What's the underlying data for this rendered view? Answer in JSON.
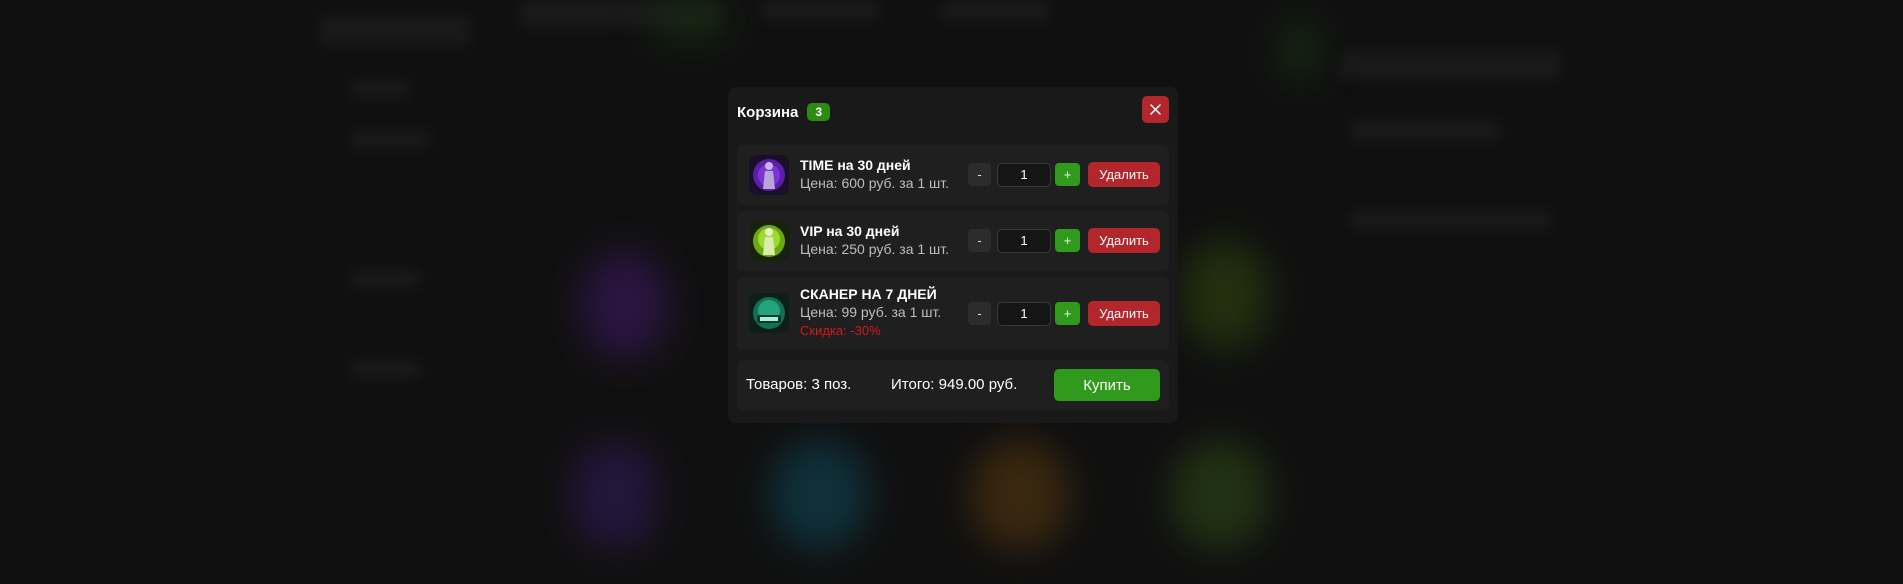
{
  "cart": {
    "title": "Корзина",
    "count_badge": "3",
    "close_icon": "close-icon",
    "items": [
      {
        "name": "TIME на 30 дней",
        "price": "Цена: 600 руб. за 1 шт.",
        "discount": "",
        "quantity": "1",
        "minus_label": "-",
        "plus_label": "+",
        "remove_label": "Удалить",
        "thumb_color": "#7b2fd0"
      },
      {
        "name": "VIP на 30 дней",
        "price": "Цена: 250 руб. за 1 шт.",
        "discount": "",
        "quantity": "1",
        "minus_label": "-",
        "plus_label": "+",
        "remove_label": "Удалить",
        "thumb_color": "#8fd41d"
      },
      {
        "name": "СКАНЕР НА 7 ДНЕЙ",
        "price": "Цена: 99 руб. за 1 шт.",
        "discount": "Скидка: -30%",
        "quantity": "1",
        "minus_label": "-",
        "plus_label": "+",
        "remove_label": "Удалить",
        "thumb_color": "#1fa876"
      }
    ],
    "footer": {
      "items_count": "Товаров: 3 поз.",
      "total": "Итого: 949.00 руб.",
      "buy_label": "Купить"
    }
  },
  "colors": {
    "accent_green": "#2f9a1c",
    "danger_red": "#b3272c",
    "discount_red": "#d11a1a",
    "modal_bg": "#191919"
  }
}
